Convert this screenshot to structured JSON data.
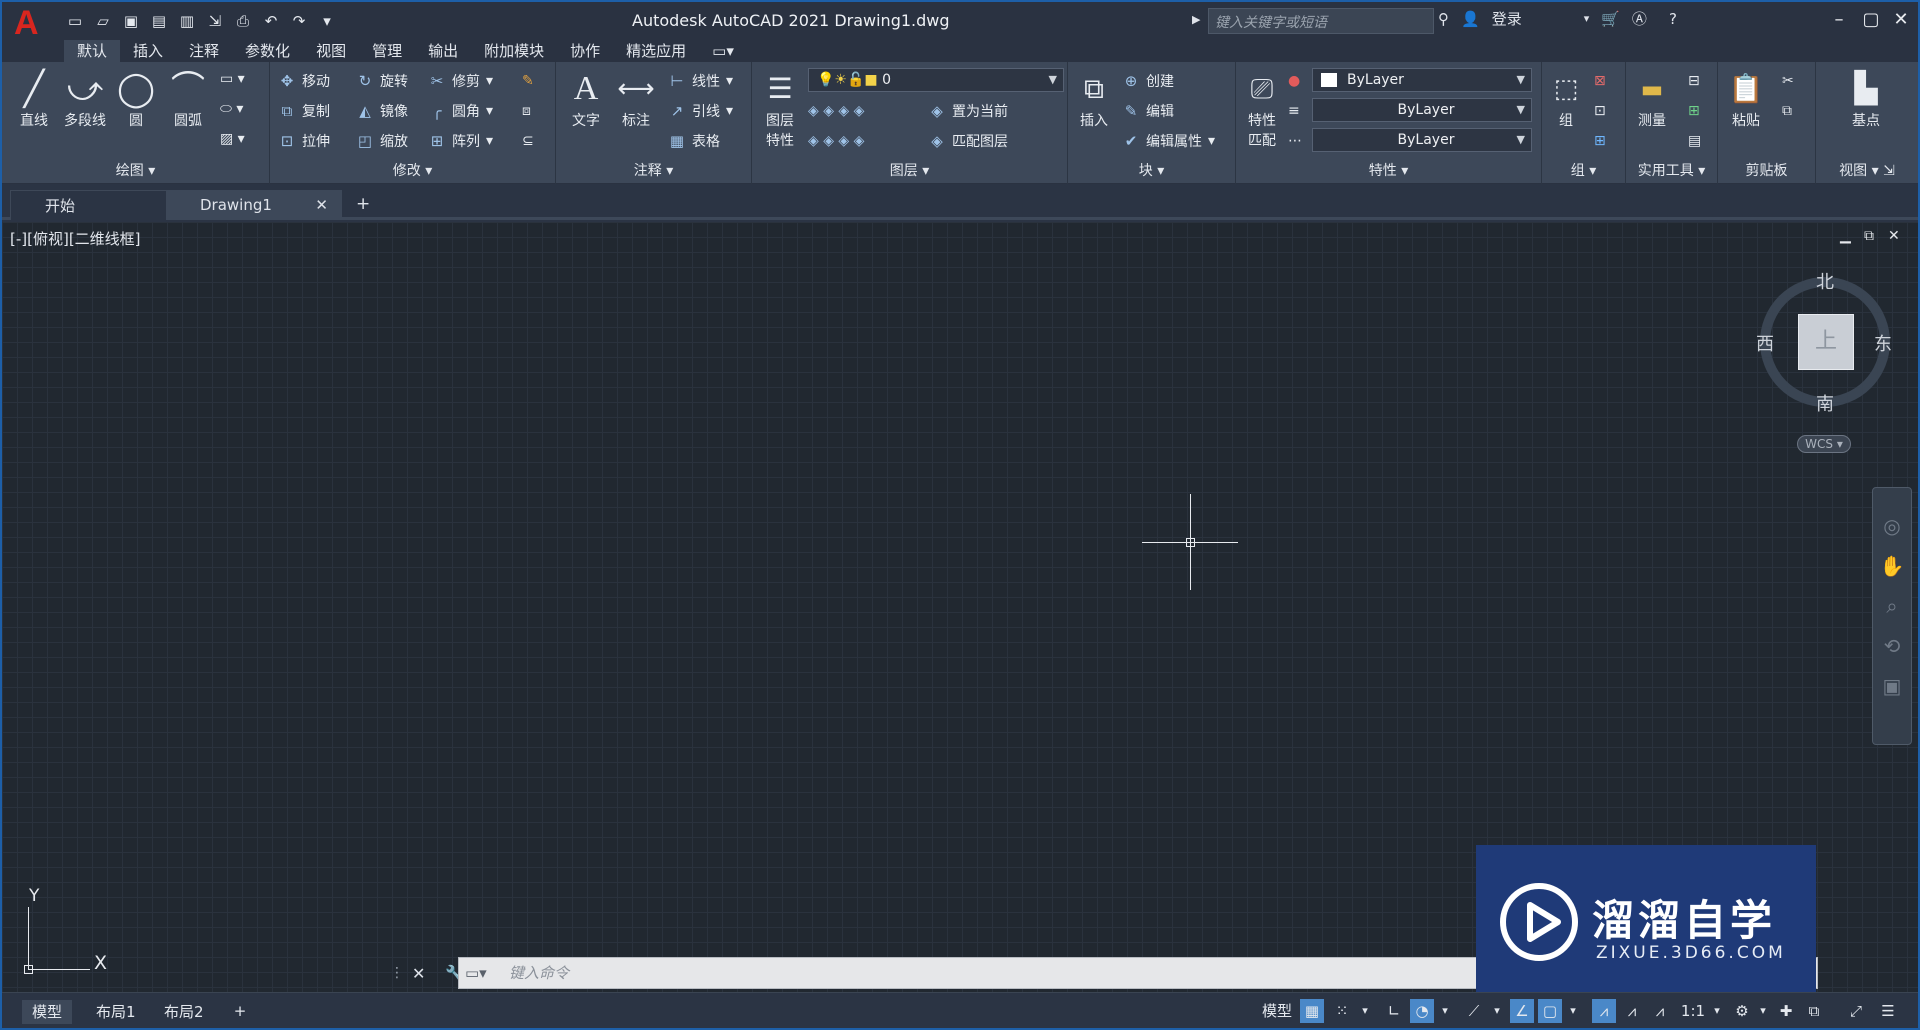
{
  "app": {
    "logo": "A",
    "title": "Autodesk AutoCAD 2021    Drawing1.dwg",
    "search_placeholder": "键入关键字或短语",
    "signin": "登录"
  },
  "ribbon_tabs": [
    "默认",
    "插入",
    "注释",
    "参数化",
    "视图",
    "管理",
    "输出",
    "附加模块",
    "协作",
    "精选应用"
  ],
  "ribbon": {
    "draw": {
      "label": "绘图",
      "line": "直线",
      "polyline": "多段线",
      "circle": "圆",
      "arc": "圆弧"
    },
    "modify": {
      "label": "修改",
      "move": "移动",
      "rotate": "旋转",
      "trim": "修剪",
      "copy": "复制",
      "mirror": "镜像",
      "fillet": "圆角",
      "stretch": "拉伸",
      "scale": "缩放",
      "array": "阵列"
    },
    "annotation": {
      "label": "注释",
      "text": "文字",
      "dimension": "标注",
      "linear": "线性",
      "leader": "引线",
      "table": "表格"
    },
    "layers": {
      "label": "图层",
      "layer_props_1": "图层",
      "layer_props_2": "特性",
      "current_layer": "0",
      "set_current": "置为当前",
      "match_layer": "匹配图层"
    },
    "block": {
      "label": "块",
      "insert": "插入",
      "create": "创建",
      "edit": "编辑",
      "edit_attr": "编辑属性"
    },
    "properties": {
      "label": "特性",
      "match_1": "特性",
      "match_2": "匹配",
      "color": "ByLayer",
      "lineweight": "ByLayer",
      "linetype": "ByLayer"
    },
    "groups": {
      "label": "组",
      "group": "组"
    },
    "utilities": {
      "label": "实用工具",
      "measure": "测量"
    },
    "clipboard": {
      "label": "剪贴板",
      "paste": "粘贴"
    },
    "view": {
      "label": "视图",
      "base": "基点"
    }
  },
  "file_tabs": {
    "start": "开始",
    "drawing": "Drawing1"
  },
  "viewport": {
    "label": "[-][俯视][二维线框]",
    "north": "北",
    "south": "南",
    "east": "东",
    "west": "西",
    "cube_face": "上",
    "wcs": "WCS",
    "ucs_y": "Y",
    "ucs_x": "X"
  },
  "command": {
    "placeholder": "键入命令"
  },
  "watermark": {
    "brand": "溜溜自学",
    "url": "ZIXUE.3D66.COM"
  },
  "layout_tabs": [
    "模型",
    "布局1",
    "布局2"
  ],
  "status": {
    "model": "模型",
    "scale": "1:1"
  }
}
